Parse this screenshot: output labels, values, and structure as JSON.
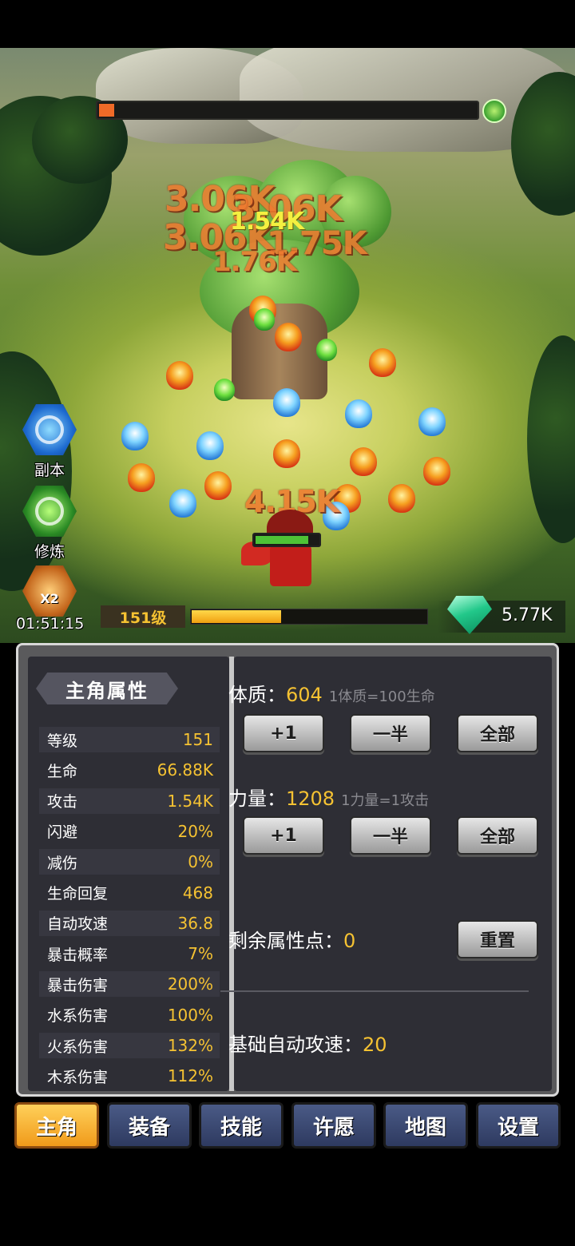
{
  "battle": {
    "boss_hp_fraction": 0.04,
    "damage_numbers": {
      "d1": "3.06K",
      "d2": "3.06K",
      "d3": "1.54K",
      "d4": "3.06K",
      "d5": "1.76K",
      "d6": "1.75K",
      "hero_hit": "4.15K"
    },
    "hero_hp_fraction": 0.85
  },
  "side_buttons": {
    "dungeon": {
      "label": "副本",
      "icon": "vortex-icon"
    },
    "cultivate": {
      "label": "修炼",
      "icon": "swirl-icon"
    },
    "boost": {
      "label": "X2",
      "icon": "treasure-pot-icon"
    }
  },
  "timer": "01:51:15",
  "status": {
    "level_label": "151级",
    "xp_fraction": 0.38,
    "gems": "5.77K",
    "gem_color": "#22c88a"
  },
  "left_panel": {
    "title": "主角属性",
    "stats": [
      {
        "name": "等级",
        "value": "151"
      },
      {
        "name": "生命",
        "value": "66.88K"
      },
      {
        "name": "攻击",
        "value": "1.54K"
      },
      {
        "name": "闪避",
        "value": "20%"
      },
      {
        "name": "减伤",
        "value": "0%"
      },
      {
        "name": "生命回复",
        "value": "468"
      },
      {
        "name": "自动攻速",
        "value": "36.8"
      },
      {
        "name": "暴击概率",
        "value": "7%"
      },
      {
        "name": "暴击伤害",
        "value": "200%"
      },
      {
        "name": "水系伤害",
        "value": "100%"
      },
      {
        "name": "火系伤害",
        "value": "132%"
      },
      {
        "name": "木系伤害",
        "value": "112%"
      }
    ]
  },
  "right_panel": {
    "constitution": {
      "label": "体质：",
      "value": "604",
      "hint": "1体质=100生命"
    },
    "strength": {
      "label": "力量：",
      "value": "1208",
      "hint": "1力量=1攻击"
    },
    "buttons": {
      "plus_one": "+1",
      "half": "一半",
      "all": "全部"
    },
    "remaining": {
      "label": "剩余属性点：",
      "value": "0"
    },
    "reset": "重置",
    "base_speed": {
      "label": "基础自动攻速：",
      "value": "20"
    }
  },
  "tabs": [
    {
      "label": "主角",
      "active": true
    },
    {
      "label": "装备"
    },
    {
      "label": "技能"
    },
    {
      "label": "许愿"
    },
    {
      "label": "地图"
    },
    {
      "label": "设置"
    }
  ],
  "colors": {
    "accent_gold": "#f5c232",
    "tab_active": "#f09a1a",
    "tab_idle": "#2e3a60"
  }
}
